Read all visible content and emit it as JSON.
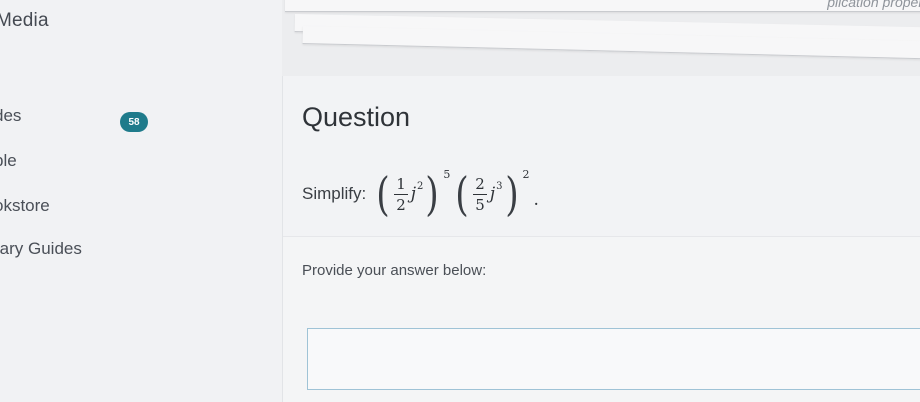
{
  "sidebar": {
    "header": "Media",
    "items": [
      {
        "label": "des",
        "badge": "58"
      },
      {
        "label": "ple"
      },
      {
        "label": "okstore"
      },
      {
        "label": "rary Guides"
      }
    ]
  },
  "top_stack": {
    "corner_text": "plication proper"
  },
  "question": {
    "title": "Question",
    "prompt_label": "Simplify:",
    "math": {
      "term1": {
        "numerator": "1",
        "denominator": "2",
        "variable": "j",
        "var_exponent": "2",
        "outer_exponent": "5"
      },
      "term2": {
        "numerator": "2",
        "denominator": "5",
        "variable": "j",
        "var_exponent": "3",
        "outer_exponent": "2"
      },
      "terminal": "."
    },
    "answer_prompt": "Provide your answer below:",
    "answer_value": ""
  },
  "colors": {
    "badge_bg": "#1f7b8b",
    "input_border": "#9fc3d6"
  }
}
